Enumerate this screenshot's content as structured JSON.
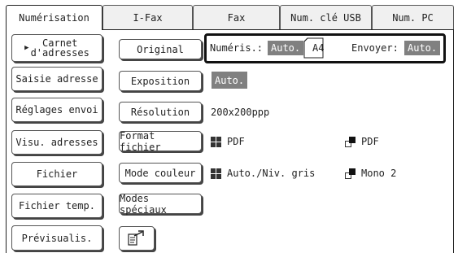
{
  "tabs": [
    {
      "label": "Numérisation",
      "active": true
    },
    {
      "label": "I-Fax",
      "active": false
    },
    {
      "label": "Fax",
      "active": false
    },
    {
      "label": "Num. clé USB",
      "active": false
    },
    {
      "label": "Num. PC",
      "active": false
    }
  ],
  "sidebar": {
    "address_book": "Carnet\nd'adresses",
    "address_entry": "Saisie adresse",
    "send_settings": "Réglages envoi",
    "view_addresses": "Visu. adresses",
    "file": "Fichier",
    "quick_file": "Fichier temp.",
    "preview": "Prévisualis."
  },
  "settings": {
    "original_label": "Original",
    "scan_label": "Numéris.:",
    "scan_value": "Auto.",
    "paper_size": "A4",
    "send_label": "Envoyer:",
    "send_value": "Auto.",
    "exposure_label": "Exposition",
    "exposure_value": "Auto.",
    "resolution_label": "Résolution",
    "resolution_value": "200x200ppp",
    "file_format_label": "Format fichier",
    "file_format_multi": "PDF",
    "file_format_single": "PDF",
    "color_mode_label": "Mode couleur",
    "color_mode_multi": "Auto./Niv. gris",
    "color_mode_single": "Mono 2",
    "special_modes_label": "Modes spéciaux"
  },
  "colors": {
    "highlight_grey": "#808080",
    "border": "#222222"
  }
}
